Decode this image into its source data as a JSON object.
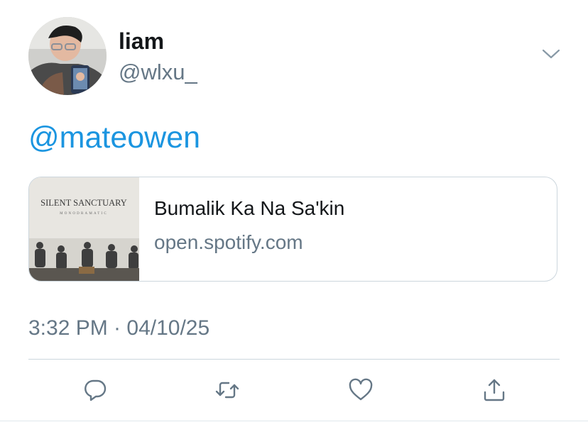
{
  "tweet": {
    "author_name": "liam",
    "author_handle": "@wlxu_",
    "mention": "@mateowen",
    "timestamp": "3:32 PM · 04/10/25"
  },
  "card": {
    "title": "Bumalik Ka Na Sa'kin",
    "domain": "open.spotify.com",
    "thumbnail": {
      "band_name": "SILENT SANCTUARY",
      "album_name": "MONODRAMATIC"
    }
  },
  "icons": {
    "more": "chevron-down-icon",
    "reply": "reply-icon",
    "retweet": "retweet-icon",
    "like": "heart-icon",
    "share": "share-icon"
  },
  "colors": {
    "link": "#1b95e0",
    "secondary_text": "#657786",
    "icon": "#657786",
    "border": "#ccd6dd"
  }
}
